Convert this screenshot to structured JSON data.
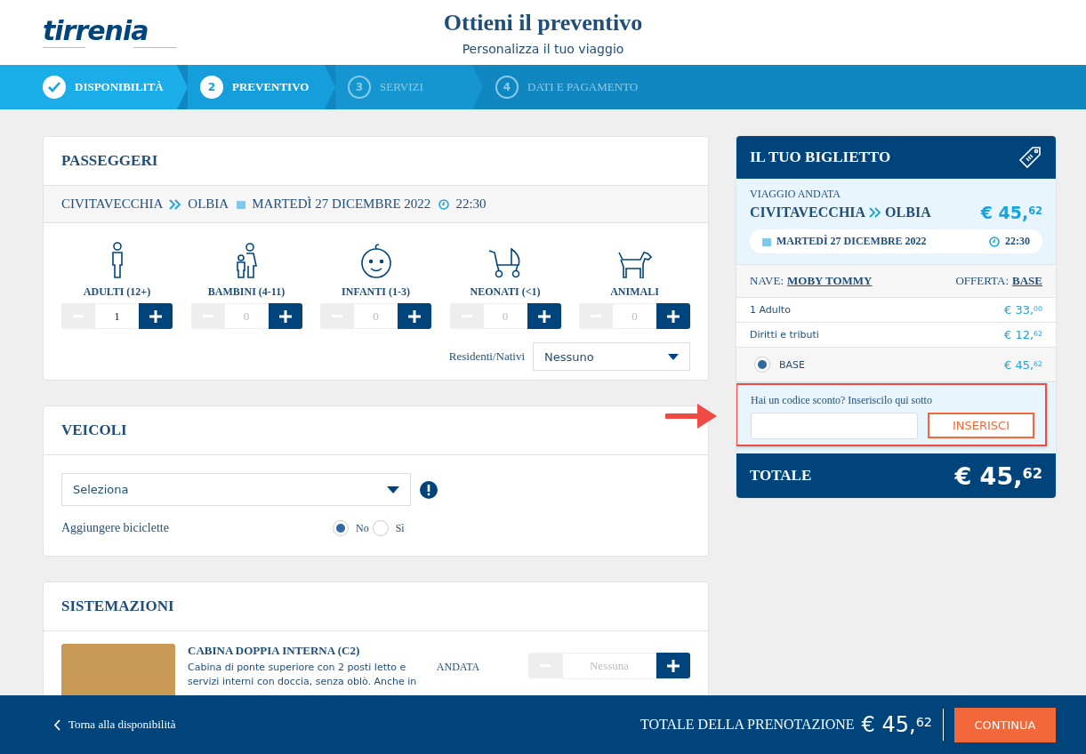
{
  "header": {
    "logo": "tirrenia",
    "title": "Ottieni il preventivo",
    "subtitle": "Personalizza il tuo viaggio"
  },
  "steps": [
    {
      "label": "DISPONIBILITÀ",
      "completed": true,
      "selected": false
    },
    {
      "number": "2",
      "label": "PREVENTIVO",
      "completed": false,
      "selected": true
    },
    {
      "number": "3",
      "label": "SERVIZI",
      "completed": false,
      "selected": false
    },
    {
      "number": "4",
      "label": "DATI E PAGAMENTO",
      "completed": false,
      "selected": false
    }
  ],
  "passengers": {
    "title": "PASSEGGERI",
    "route": {
      "from": "CIVITAVECCHIA",
      "to": "OLBIA",
      "date": "MARTEDÌ 27 DICEMBRE 2022",
      "time": "22:30"
    },
    "counters": [
      {
        "kind": "adult",
        "label": "ADULTI (12+)",
        "value": "1",
        "muted": false
      },
      {
        "kind": "child",
        "label": "BAMBINI (4-11)",
        "value": "0",
        "muted": true
      },
      {
        "kind": "infant",
        "label": "INFANTI (1-3)",
        "value": "0",
        "muted": true
      },
      {
        "kind": "newborn",
        "label": "NEONATI (<1)",
        "value": "0",
        "muted": true
      },
      {
        "kind": "animal",
        "label": "ANIMALI",
        "value": "0",
        "muted": true
      }
    ],
    "residents": {
      "label": "Residenti/Nativi",
      "value": "Nessuno"
    }
  },
  "vehicles": {
    "title": "VEICOLI",
    "select": {
      "value": "Seleziona"
    },
    "bikes": {
      "label": "Aggiungere biciclette",
      "options": [
        {
          "label": "No",
          "selected": true
        },
        {
          "label": "Sì",
          "selected": false
        }
      ]
    }
  },
  "accommodations": {
    "title": "SISTEMAZIONI",
    "items": [
      {
        "name": "CABINA DOPPIA INTERNA (C2)",
        "description": "Cabina di ponte superiore con 2 posti letto e servizi interni con doccia, senza oblò. Anche in",
        "direction": "ANDATA",
        "placeholder": "Nessuna"
      }
    ]
  },
  "ticket": {
    "title": "IL TUO BIGLIETTO",
    "trip_label": "VIAGGIO ANDATA",
    "from": "CIVITAVECCHIA",
    "to": "OLBIA",
    "price": "€ 45,$^{62}$",
    "date": "MARTEDÌ 27 DICEMBRE 2022",
    "time": "22:30",
    "ship_label": "NAVE:",
    "ship": "MOBY TOMMY",
    "offer_label": "OFFERTA:",
    "offer": "BASE",
    "lines": [
      {
        "label": "1 Adulto",
        "price": "€ 33,$^{00}$"
      },
      {
        "label": "Diritti e tributi",
        "price": "€ 12,$^{62}$"
      }
    ],
    "fares": [
      {
        "label": "BASE",
        "price": "€ 45,$^{62}$",
        "selected": true
      }
    ],
    "discount": {
      "prompt": "Hai un codice sconto? Inseriscilo qui sotto",
      "button": "INSERISCI"
    },
    "total_label": "TOTALE",
    "total": "€ 45,$^{62}$"
  },
  "footer": {
    "back": "Torna alla disponibilità",
    "total_label": "TOTALE DELLA PRENOTAZIONE",
    "total": "€ 45,$^{62}$",
    "button": "CONTINUA"
  }
}
